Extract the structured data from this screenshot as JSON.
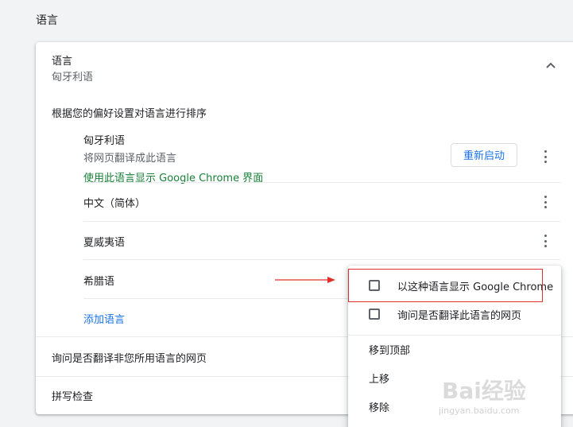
{
  "section": {
    "title": "语言"
  },
  "language_panel": {
    "title": "语言",
    "current_language": "匈牙利语",
    "order_description": "根据您的偏好设置对语言进行排序",
    "languages": [
      {
        "name": "匈牙利语",
        "subtitle": "将网页翻译成此语言",
        "status": "使用此语言显示 Google Chrome 界面",
        "action_label": "重新启动"
      },
      {
        "name": "中文（简体）"
      },
      {
        "name": "夏威夷语"
      },
      {
        "name": "希腊语"
      }
    ],
    "add_language": "添加语言",
    "ask_translate": "询问是否翻译非您所用语言的网页",
    "spellcheck": "拼写检查"
  },
  "context_menu": {
    "display_in_language": "以这种语言显示 Google Chrome",
    "offer_translate": "询问是否翻译此语言的网页",
    "move_to_top": "移到顶部",
    "move_up": "上移",
    "remove": "移除"
  },
  "watermark": {
    "brand": "Bai经验",
    "url": "jingyan.baidu.com"
  },
  "colors": {
    "link_green": "#188038",
    "link_blue": "#1a73e8",
    "highlight_red": "#e0302a"
  }
}
